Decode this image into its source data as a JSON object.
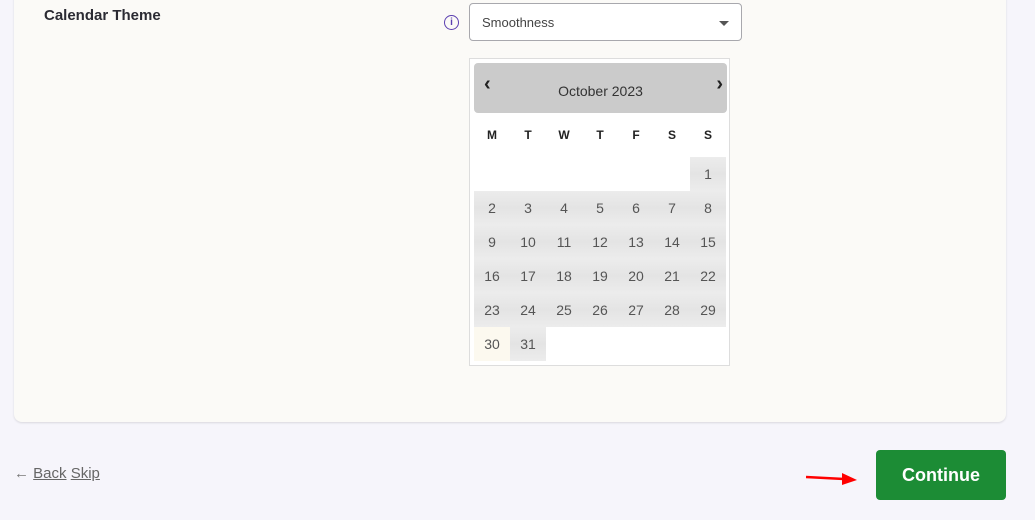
{
  "setting": {
    "label": "Calendar Theme",
    "info_icon": "info-icon",
    "selected": "Smoothness"
  },
  "calendar": {
    "month": "October 2023",
    "prev": "‹",
    "next": "›",
    "weekdays": [
      "M",
      "T",
      "W",
      "T",
      "F",
      "S",
      "S"
    ],
    "weeks": [
      [
        "",
        "",
        "",
        "",
        "",
        "",
        "1"
      ],
      [
        "2",
        "3",
        "4",
        "5",
        "6",
        "7",
        "8"
      ],
      [
        "9",
        "10",
        "11",
        "12",
        "13",
        "14",
        "15"
      ],
      [
        "16",
        "17",
        "18",
        "19",
        "20",
        "21",
        "22"
      ],
      [
        "23",
        "24",
        "25",
        "26",
        "27",
        "28",
        "29"
      ],
      [
        "30",
        "31",
        "",
        "",
        "",
        "",
        ""
      ]
    ],
    "today": "30"
  },
  "footer": {
    "back": "Back",
    "skip": "Skip",
    "continue": "Continue"
  },
  "colors": {
    "accent": "#1c8c35",
    "arrow": "#ff0000"
  }
}
